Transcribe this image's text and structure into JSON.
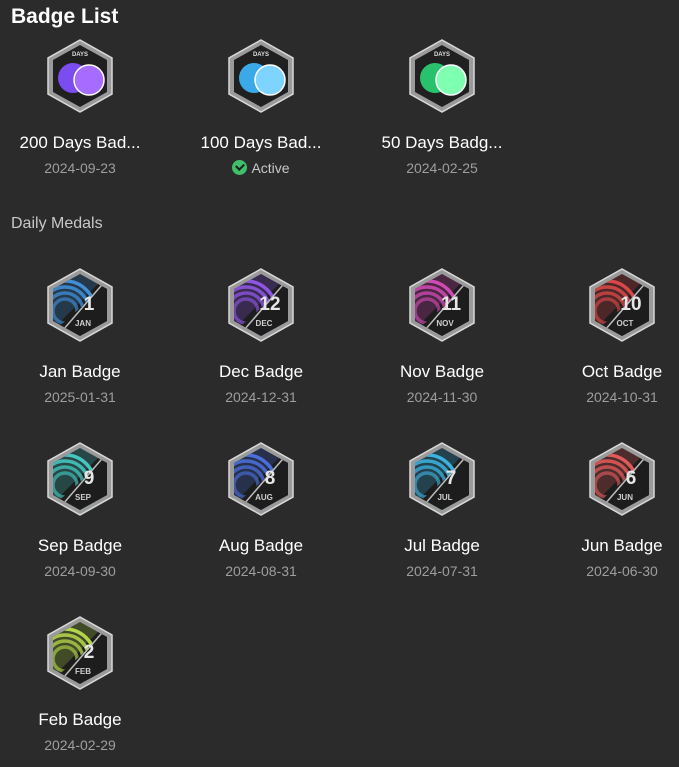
{
  "header": {
    "title": "Badge List"
  },
  "streak_badges": [
    {
      "name": "200 Days Bad...",
      "date": "2024-09-23",
      "icon": "days-200-badge-icon",
      "label": "DAYS",
      "color1": "#7b4cf0",
      "color2": "#a66bff"
    },
    {
      "name": "100 Days Bad...",
      "status": "Active",
      "icon": "days-100-badge-icon",
      "label": "DAYS",
      "color1": "#3aa9e8",
      "color2": "#7fd3ff"
    },
    {
      "name": "50 Days Badg...",
      "date": "2024-02-25",
      "icon": "days-50-badge-icon",
      "label": "DAYS",
      "color1": "#27c26b",
      "color2": "#7fffb0"
    }
  ],
  "section": {
    "daily_label": "Daily Medals"
  },
  "daily_medals": [
    {
      "name": "Jan Badge",
      "date": "2025-01-31",
      "num": "1",
      "month": "JAN",
      "color": "#3f8fd8",
      "icon": "jan-medal-icon"
    },
    {
      "name": "Dec Badge",
      "date": "2024-12-31",
      "num": "12",
      "month": "DEC",
      "color": "#8f56e6",
      "icon": "dec-medal-icon"
    },
    {
      "name": "Nov Badge",
      "date": "2024-11-30",
      "num": "11",
      "month": "NOV",
      "color": "#d049b4",
      "icon": "nov-medal-icon"
    },
    {
      "name": "Oct Badge",
      "date": "2024-10-31",
      "num": "10",
      "month": "OCT",
      "color": "#d94848",
      "icon": "oct-medal-icon"
    },
    {
      "name": "Sep Badge",
      "date": "2024-09-30",
      "num": "9",
      "month": "SEP",
      "color": "#45c7c0",
      "icon": "sep-medal-icon"
    },
    {
      "name": "Aug Badge",
      "date": "2024-08-31",
      "num": "8",
      "month": "AUG",
      "color": "#4a6fdc",
      "icon": "aug-medal-icon"
    },
    {
      "name": "Jul Badge",
      "date": "2024-07-31",
      "num": "7",
      "month": "JUL",
      "color": "#3bb2e0",
      "icon": "jul-medal-icon"
    },
    {
      "name": "Jun Badge",
      "date": "2024-06-30",
      "num": "6",
      "month": "JUN",
      "color": "#e05a5a",
      "icon": "jun-medal-icon"
    },
    {
      "name": "Feb Badge",
      "date": "2024-02-29",
      "num": "2",
      "month": "FEB",
      "color": "#b4d64a",
      "icon": "feb-medal-icon"
    }
  ]
}
